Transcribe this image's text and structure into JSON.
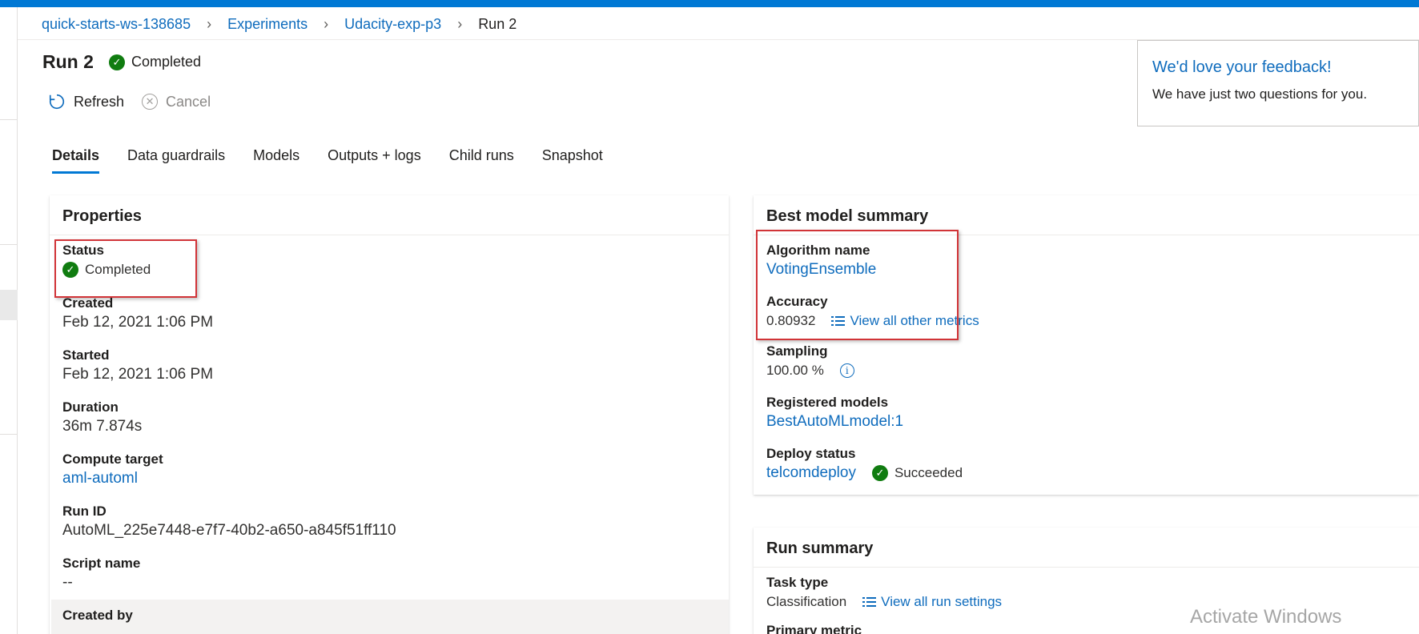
{
  "breadcrumb": {
    "items": [
      "quick-starts-ws-138685",
      "Experiments",
      "Udacity-exp-p3"
    ],
    "current": "Run 2"
  },
  "header": {
    "title": "Run 2",
    "status": "Completed"
  },
  "toolbar": {
    "refresh_label": "Refresh",
    "cancel_label": "Cancel"
  },
  "tabs": [
    {
      "label": "Details"
    },
    {
      "label": "Data guardrails"
    },
    {
      "label": "Models"
    },
    {
      "label": "Outputs + logs"
    },
    {
      "label": "Child runs"
    },
    {
      "label": "Snapshot"
    }
  ],
  "feedback": {
    "title": "We'd love your feedback!",
    "body": "We have just two questions for you."
  },
  "properties": {
    "title": "Properties",
    "status_label": "Status",
    "status_value": "Completed",
    "created_label": "Created",
    "created_value": "Feb 12, 2021 1:06 PM",
    "started_label": "Started",
    "started_value": "Feb 12, 2021 1:06 PM",
    "duration_label": "Duration",
    "duration_value": "36m 7.874s",
    "compute_label": "Compute target",
    "compute_value": "aml-automl",
    "runid_label": "Run ID",
    "runid_value": "AutoML_225e7448-e7f7-40b2-a650-a845f51ff110",
    "script_label": "Script name",
    "script_value": "--",
    "createdby_label": "Created by"
  },
  "best_model": {
    "title": "Best model summary",
    "algo_label": "Algorithm name",
    "algo_value": "VotingEnsemble",
    "acc_label": "Accuracy",
    "acc_value": "0.80932",
    "metrics_link": "View all other metrics",
    "sampling_label": "Sampling",
    "sampling_value": "100.00 %",
    "registered_label": "Registered models",
    "registered_value": "BestAutoMLmodel:1",
    "deploy_label": "Deploy status",
    "deploy_value": "telcomdeploy",
    "deploy_status": "Succeeded"
  },
  "run_summary": {
    "title": "Run summary",
    "task_label": "Task type",
    "task_value": "Classification",
    "settings_link": "View all run settings",
    "primary_label": "Primary metric"
  },
  "watermark": "Activate Windows",
  "colors": {
    "accent": "#0078d4",
    "link": "#0f6cbd",
    "success": "#107c10",
    "highlight": "#d13438"
  }
}
